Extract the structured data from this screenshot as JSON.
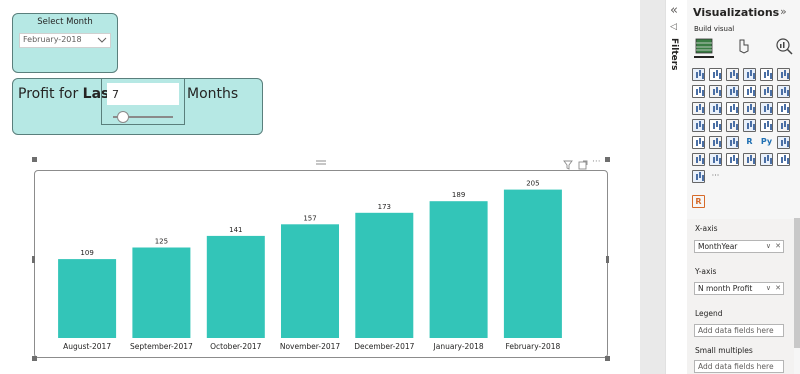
{
  "slicer": {
    "title": "Select Month",
    "selected": "February-2018"
  },
  "parameter": {
    "prefix_regular": "Profit for ",
    "prefix_bold": "Last",
    "value": "7",
    "suffix": "Months",
    "slider_fraction": 0.17
  },
  "chart_data": {
    "type": "bar",
    "categories": [
      "August-2017",
      "September-2017",
      "October-2017",
      "November-2017",
      "December-2017",
      "January-2018",
      "February-2018"
    ],
    "values": [
      109,
      125,
      141,
      157,
      173,
      189,
      205
    ],
    "data_labels": [
      "109",
      "125",
      "141",
      "157",
      "173",
      "189",
      "205"
    ],
    "title": "",
    "xlabel": "",
    "ylabel": "",
    "ylim": [
      0,
      221
    ],
    "grid": false,
    "bar_color": "#33c5b8"
  },
  "filters_pane": {
    "label": "Filters",
    "collapse_icon": "double-chevron-left-icon"
  },
  "visualizations": {
    "title": "Visualizations",
    "build_label": "Build visual",
    "icon_text": {
      "r": "R",
      "py": "Py",
      "more": "···"
    }
  },
  "fields": {
    "xaxis": {
      "title": "X-axis",
      "value": "MonthYear"
    },
    "yaxis": {
      "title": "Y-axis",
      "value": "N month Profit"
    },
    "legend": {
      "title": "Legend",
      "placeholder": "Add data fields here"
    },
    "small_multiples": {
      "title": "Small multiples",
      "placeholder": "Add data fields here"
    }
  },
  "colors": {
    "card_bg": "#b6e8e4",
    "card_border": "#5a7f7c",
    "bar": "#33c5b8",
    "pane_bg": "#f6f6f6"
  }
}
